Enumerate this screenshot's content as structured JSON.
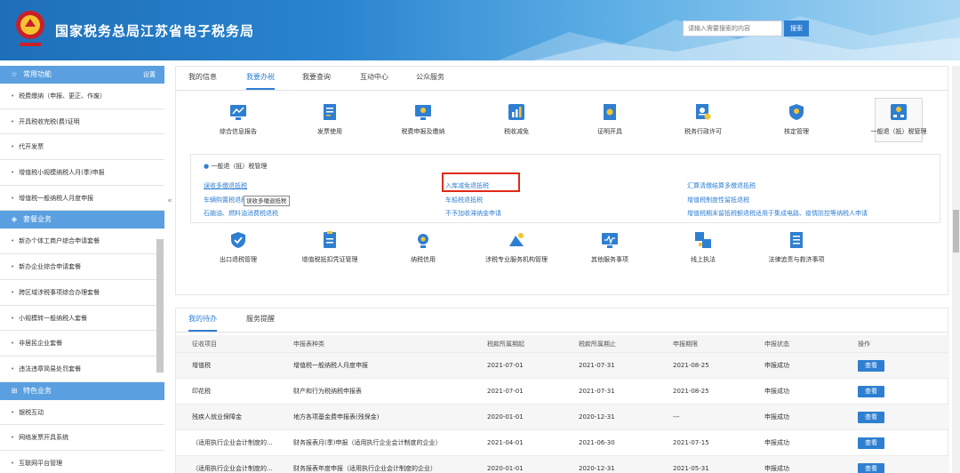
{
  "header": {
    "site_title": "国家税务总局江苏省电子税务局",
    "search_placeholder": "请输入需要搜索的内容",
    "search_button": "搜索"
  },
  "sidebar": {
    "common": {
      "title": "常用功能",
      "settings": "设置",
      "items": [
        "税费缴纳（申报、更正、作废）",
        "开具税收完税(费)证明",
        "代开发票",
        "增值税小规模纳税人月(季)申报",
        "增值税一般纳税人月度申报"
      ]
    },
    "packages": {
      "title": "套餐业务",
      "items": [
        "新办个体工商户综合申请套餐",
        "新办企业综合申请套餐",
        "跨区域涉税事项综合办理套餐",
        "小规模转一般纳税人套餐",
        "非居民企业套餐",
        "违法违章简易处罚套餐"
      ]
    },
    "special": {
      "title": "特色业务",
      "items": [
        "银税互动",
        "网络发票开具系统",
        "互联网平台管理"
      ]
    },
    "collapse_glyph": "«"
  },
  "main": {
    "tabs": [
      "我的信息",
      "我要办税",
      "我要查询",
      "互动中心",
      "公众服务"
    ],
    "active_tab": "我要办税",
    "icons_row1": [
      {
        "label": "综合信息报告",
        "icon": "report-icon"
      },
      {
        "label": "发票使用",
        "icon": "invoice-icon"
      },
      {
        "label": "税费申报及缴纳",
        "icon": "declare-icon"
      },
      {
        "label": "税收减免",
        "icon": "reduction-icon"
      },
      {
        "label": "证明开具",
        "icon": "certificate-icon"
      },
      {
        "label": "税务行政许可",
        "icon": "permit-icon"
      },
      {
        "label": "核定管理",
        "icon": "verify-icon"
      },
      {
        "label": "一般退（抵）税管理",
        "icon": "refund-icon"
      }
    ],
    "sub_panel": {
      "title": "一般退（抵）税管理",
      "links": [
        [
          "误收多缴退抵税",
          "入库减免退抵税",
          "汇算清缴结算多缴退抵税"
        ],
        [
          "车辆购置税退税",
          "车船税退抵税",
          "增值税制度性留抵退税"
        ],
        [
          "石脑油、燃料油消费税退税",
          "不予加收滞纳金申请",
          "增值税期末留抵税额退税适用于集成电路、疫情防控等纳税人申请"
        ]
      ],
      "tooltip": "误收多缴退抵税"
    },
    "icons_row2": [
      {
        "label": "出口退税管理",
        "icon": "export-refund-icon"
      },
      {
        "label": "增值税抵扣凭证管理",
        "icon": "voucher-icon"
      },
      {
        "label": "纳税信用",
        "icon": "credit-icon"
      },
      {
        "label": "涉税专业服务机构管理",
        "icon": "agency-icon"
      },
      {
        "label": "其他服务事项",
        "icon": "monitor-icon"
      },
      {
        "label": "线上执法",
        "icon": "law-icon"
      },
      {
        "label": "法律追责与救济事项",
        "icon": "legal-icon"
      }
    ]
  },
  "todo": {
    "tabs": [
      "我的待办",
      "服务提醒"
    ],
    "active_tab": "我的待办",
    "columns": [
      "征收项目",
      "申报表种类",
      "税款所属期起",
      "税款所属期止",
      "申报期限",
      "申报状态",
      "操作"
    ],
    "rows": [
      [
        "增值税",
        "增值税一般纳税人月度申报",
        "2021-07-01",
        "2021-07-31",
        "2021-08-25",
        "申报成功",
        "查看"
      ],
      [
        "印花税",
        "财产和行为税纳税申报表",
        "2021-07-01",
        "2021-07-31",
        "2021-08-25",
        "申报成功",
        "查看"
      ],
      [
        "残疾人就业保障金",
        "地方各项基金费申报表(残保金)",
        "2020-01-01",
        "2020-12-31",
        "---",
        "申报成功",
        "查看"
      ],
      [
        "（适用执行企业会计制度的...",
        "财务报表月(季)申报（适用执行企业会计制度的企业）",
        "2021-04-01",
        "2021-06-30",
        "2021-07-15",
        "申报成功",
        "查看"
      ],
      [
        "（适用执行企业会计制度的...",
        "财务报表年度申报（适用执行企业会计制度的企业）",
        "2020-01-01",
        "2020-12-31",
        "2021-05-31",
        "申报成功",
        "查看"
      ]
    ]
  },
  "colors": {
    "brand": "#2f7fd1",
    "sidebar_header": "#5a9fe0",
    "highlight": "#e02a1a"
  }
}
